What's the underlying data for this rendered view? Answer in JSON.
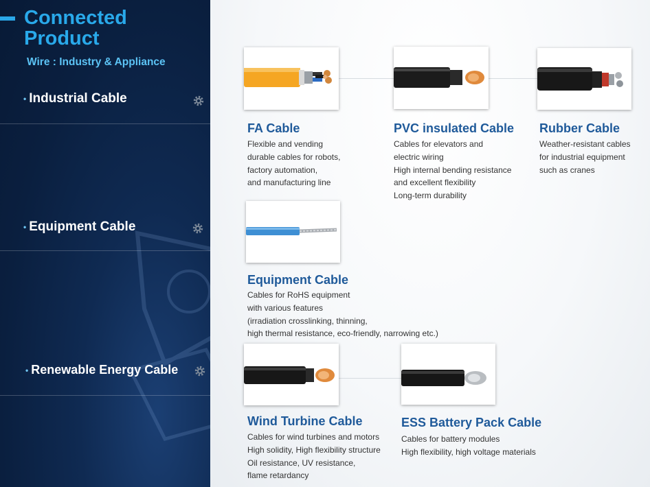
{
  "header": {
    "title_line1": "Connected",
    "title_line2": "Product",
    "subtitle": "Wire : Industry & Appliance"
  },
  "categories": [
    {
      "label": "Industrial Cable",
      "icon": "gear-icon"
    },
    {
      "label": "Equipment Cable",
      "icon": "gear-icon"
    },
    {
      "label": "Renewable Energy Cable",
      "icon": "gear-icon"
    }
  ],
  "products": {
    "fa": {
      "name": "FA Cable",
      "lines": [
        "Flexible and vending",
        "durable cables for robots,",
        "factory automation,",
        "and manufacturing line"
      ]
    },
    "pvc": {
      "name": "PVC insulated Cable",
      "lines": [
        "Cables for elevators and",
        "electric wiring",
        "High internal bending resistance",
        "and excellent flexibility",
        "Long-term durability"
      ]
    },
    "rubber": {
      "name": "Rubber  Cable",
      "lines": [
        "Weather-resistant cables",
        "for industrial equipment",
        "such as cranes"
      ]
    },
    "equipment": {
      "name": "Equipment Cable",
      "lines": [
        "Cables for RoHS equipment",
        "with various features",
        "(irradiation crosslinking, thinning,",
        "high thermal resistance, eco-friendly, narrowing etc.)"
      ]
    },
    "wind": {
      "name": "Wind Turbine Cable",
      "lines": [
        "Cables for wind turbines and motors",
        "High solidity, High flexibility structure",
        "Oil resistance, UV resistance,",
        "flame retardancy"
      ]
    },
    "ess": {
      "name": "ESS Battery Pack Cable",
      "lines": [
        "Cables for battery modules",
        "High flexibility, high voltage materials"
      ]
    }
  },
  "colors": {
    "panel": "#0a1f3f",
    "accent": "#29a9ea",
    "product_title": "#1f5a9a"
  }
}
